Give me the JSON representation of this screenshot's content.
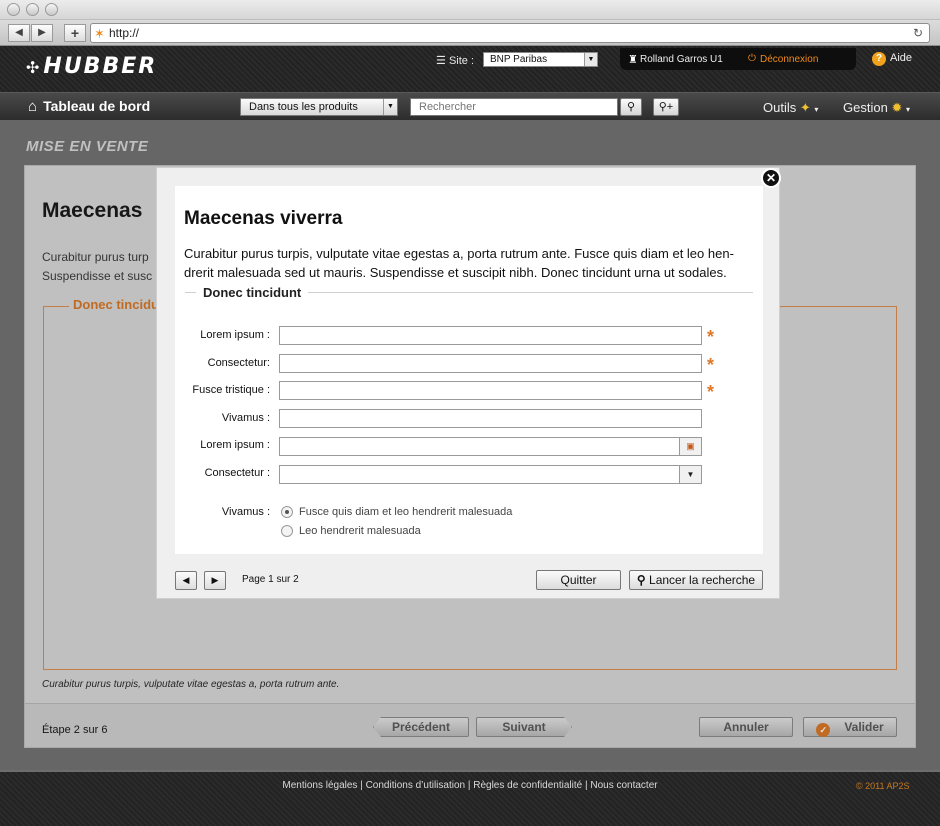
{
  "browser": {
    "url": "http://",
    "back_icon": "◀",
    "forward_icon": "▶",
    "add_icon": "+",
    "reload_icon": "↻"
  },
  "header": {
    "logo_text": "HUBBER",
    "site_label": "Site :",
    "site_value": "BNP Paribas",
    "user_name": "Rolland Garros U1",
    "logout_label": "Déconnexion",
    "help_label": "Aide"
  },
  "nav": {
    "home_label": "Tableau de bord",
    "scope_value": "Dans tous les produits",
    "search_placeholder": "Rechercher",
    "tools_label": "Outils",
    "manage_label": "Gestion"
  },
  "page": {
    "section_title": "MISE EN VENTE",
    "title": "Maecenas",
    "description_line1": "Curabitur purus turp",
    "description_line2": "Suspendisse et susc",
    "fieldset_legend": "Donec tincidu",
    "note": "Curabitur purus turpis, vulputate vitae egestas a, porta rutrum ante.",
    "step_text": "Étape 2 sur 6",
    "prev_label": "Précédent",
    "next_label": "Suivant",
    "cancel_label": "Annuler",
    "validate_label": "Valider"
  },
  "modal": {
    "title": "Maecenas viverra",
    "description": "Curabitur purus turpis, vulputate vitae egestas a, porta rutrum ante. Fusce quis diam et leo hen-drerit malesuada sed ut mauris. Suspendisse et suscipit nibh. Donec tincidunt urna ut sodales.",
    "fieldset_legend": "Donec tincidunt",
    "fields": [
      {
        "label": "Lorem ipsum :",
        "value": "",
        "required": true
      },
      {
        "label": "Consectetur:",
        "value": "",
        "required": true
      },
      {
        "label": "Fusce tristique :",
        "value": "",
        "required": true
      },
      {
        "label": "Vivamus :",
        "value": "",
        "required": false
      },
      {
        "label": "Lorem ipsum :",
        "value": "",
        "required": false
      },
      {
        "label": "Consectetur :",
        "value": "",
        "required": false
      }
    ],
    "radio_label": "Vivamus :",
    "radio_options": [
      {
        "label": "Fusce quis diam et leo hendrerit malesuada",
        "selected": true
      },
      {
        "label": "Leo hendrerit malesuada",
        "selected": false
      }
    ],
    "page_info": "Page 1 sur 2",
    "quit_label": "Quitter",
    "search_label": "Lancer la recherche",
    "required_mark": "*"
  },
  "footer": {
    "links": "Mentions légales | Conditions d’utilisation | Règles de confidentialité | Nous contacter",
    "copyright": "© 2011 AP2S"
  },
  "colors": {
    "accent": "#d9731e",
    "header_bg": "#262626",
    "modal_bg": "#efefef"
  }
}
